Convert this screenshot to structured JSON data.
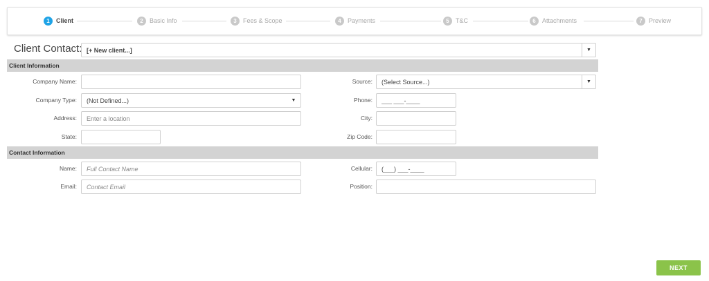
{
  "stepper": [
    {
      "num": "1",
      "label": "Client",
      "active": true
    },
    {
      "num": "2",
      "label": "Basic Info",
      "active": false
    },
    {
      "num": "3",
      "label": "Fees & Scope",
      "active": false
    },
    {
      "num": "4",
      "label": "Payments",
      "active": false
    },
    {
      "num": "5",
      "label": "T&C",
      "active": false
    },
    {
      "num": "6",
      "label": "Attachments",
      "active": false
    },
    {
      "num": "7",
      "label": "Preview",
      "active": false
    }
  ],
  "client_contact": {
    "label": "Client Contact:",
    "value": "[+ New client...]",
    "arrow": "▼"
  },
  "client_info": {
    "header": "Client Information",
    "company_name": {
      "label": "Company Name:",
      "value": "",
      "placeholder": ""
    },
    "source": {
      "label": "Source:",
      "value": "(Select Source...)",
      "arrow": "▼"
    },
    "company_type": {
      "label": "Company Type:",
      "value": "(Not Defined...)",
      "arrow": "▼"
    },
    "phone": {
      "label": "Phone:",
      "value": "___ ___-____"
    },
    "address": {
      "label": "Address:",
      "placeholder": "Enter a location"
    },
    "city": {
      "label": "City:",
      "value": ""
    },
    "state": {
      "label": "State:",
      "value": ""
    },
    "zip": {
      "label": "Zip Code:",
      "value": ""
    }
  },
  "contact_info": {
    "header": "Contact Information",
    "name": {
      "label": "Name:",
      "placeholder": "Full Contact Name"
    },
    "cellular": {
      "label": "Cellular:",
      "value": "(___) ___-____"
    },
    "email": {
      "label": "Email:",
      "placeholder": "Contact Email"
    },
    "position": {
      "label": "Position:",
      "value": ""
    }
  },
  "next_button": "NEXT",
  "colors": {
    "accent": "#1fa3e6",
    "next": "#8bc34a",
    "section_bar": "#d3d3d3"
  }
}
